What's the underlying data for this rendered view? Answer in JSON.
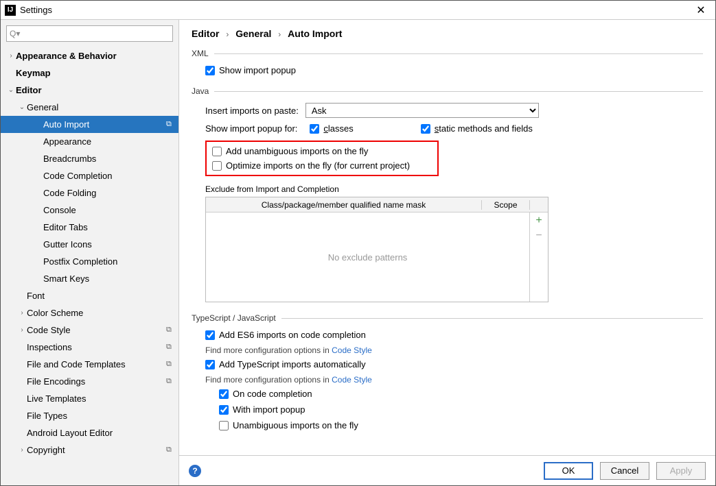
{
  "window": {
    "title": "Settings"
  },
  "search": {
    "placeholder": ""
  },
  "tree": {
    "items": [
      {
        "label": "Appearance & Behavior",
        "indent": 0,
        "arrow": "right",
        "bold": true
      },
      {
        "label": "Keymap",
        "indent": 0,
        "arrow": "",
        "bold": true
      },
      {
        "label": "Editor",
        "indent": 0,
        "arrow": "down",
        "bold": true
      },
      {
        "label": "General",
        "indent": 1,
        "arrow": "down"
      },
      {
        "label": "Auto Import",
        "indent": 2,
        "selected": true,
        "copy": true
      },
      {
        "label": "Appearance",
        "indent": 2
      },
      {
        "label": "Breadcrumbs",
        "indent": 2
      },
      {
        "label": "Code Completion",
        "indent": 2
      },
      {
        "label": "Code Folding",
        "indent": 2
      },
      {
        "label": "Console",
        "indent": 2
      },
      {
        "label": "Editor Tabs",
        "indent": 2
      },
      {
        "label": "Gutter Icons",
        "indent": 2
      },
      {
        "label": "Postfix Completion",
        "indent": 2
      },
      {
        "label": "Smart Keys",
        "indent": 2
      },
      {
        "label": "Font",
        "indent": 1
      },
      {
        "label": "Color Scheme",
        "indent": 1,
        "arrow": "right"
      },
      {
        "label": "Code Style",
        "indent": 1,
        "arrow": "right",
        "copy": true
      },
      {
        "label": "Inspections",
        "indent": 1,
        "copy": true
      },
      {
        "label": "File and Code Templates",
        "indent": 1,
        "copy": true
      },
      {
        "label": "File Encodings",
        "indent": 1,
        "copy": true
      },
      {
        "label": "Live Templates",
        "indent": 1
      },
      {
        "label": "File Types",
        "indent": 1
      },
      {
        "label": "Android Layout Editor",
        "indent": 1
      },
      {
        "label": "Copyright",
        "indent": 1,
        "arrow": "right",
        "copy": true
      }
    ]
  },
  "breadcrumb": [
    "Editor",
    "General",
    "Auto Import"
  ],
  "xml": {
    "title": "XML",
    "show_import_popup": "Show import popup",
    "show_import_popup_checked": true
  },
  "java": {
    "title": "Java",
    "insert_label": "Insert imports on paste:",
    "insert_value": "Ask",
    "popup_label": "Show import popup for:",
    "classes": "classes",
    "classes_checked": true,
    "static": "static methods and fields",
    "static_checked": true,
    "add_unambiguous": "Add unambiguous imports on the fly",
    "add_unambiguous_checked": false,
    "optimize": "Optimize imports on the fly (for current project)",
    "optimize_checked": false,
    "exclude_title": "Exclude from Import and Completion",
    "exclude_col1": "Class/package/member qualified name mask",
    "exclude_col2": "Scope",
    "exclude_empty": "No exclude patterns"
  },
  "ts": {
    "title": "TypeScript / JavaScript",
    "add_es6": "Add ES6 imports on code completion",
    "add_es6_checked": true,
    "hint1_pre": "Find more configuration options in ",
    "hint1_link": "Code Style",
    "add_ts": "Add TypeScript imports automatically",
    "add_ts_checked": true,
    "hint2_pre": "Find more configuration options in ",
    "hint2_link": "Code Style",
    "on_code": "On code completion",
    "on_code_checked": true,
    "with_popup": "With import popup",
    "with_popup_checked": true,
    "unambiguous": "Unambiguous imports on the fly",
    "unambiguous_checked": false
  },
  "footer": {
    "ok": "OK",
    "cancel": "Cancel",
    "apply": "Apply"
  }
}
